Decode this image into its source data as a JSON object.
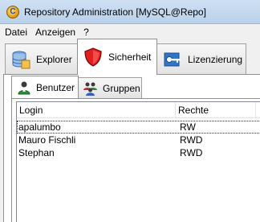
{
  "window": {
    "title": "Repository Administration [MySQL@Repo]",
    "icon": "app-logo-icon"
  },
  "menu": {
    "items": [
      {
        "label": "Datei"
      },
      {
        "label": "Anzeigen"
      },
      {
        "label": "?"
      }
    ]
  },
  "tabs": {
    "active": "Sicherheit",
    "items": [
      {
        "label": "Explorer",
        "icon": "database-icon"
      },
      {
        "label": "Sicherheit",
        "icon": "shield-icon"
      },
      {
        "label": "Lizenzierung",
        "icon": "key-icon"
      }
    ]
  },
  "security_tabs": {
    "active": "Benutzer",
    "items": [
      {
        "label": "Benutzer",
        "icon": "user-icon"
      },
      {
        "label": "Gruppen",
        "icon": "group-icon"
      }
    ]
  },
  "users_table": {
    "columns": [
      "Login",
      "Rechte"
    ],
    "rows": [
      {
        "login": "apalumbo",
        "rechte": "RW"
      },
      {
        "login": "Mauro Fischli",
        "rechte": "RWD"
      },
      {
        "login": "Stephan",
        "rechte": "RWD"
      }
    ],
    "selected_row": 0
  }
}
